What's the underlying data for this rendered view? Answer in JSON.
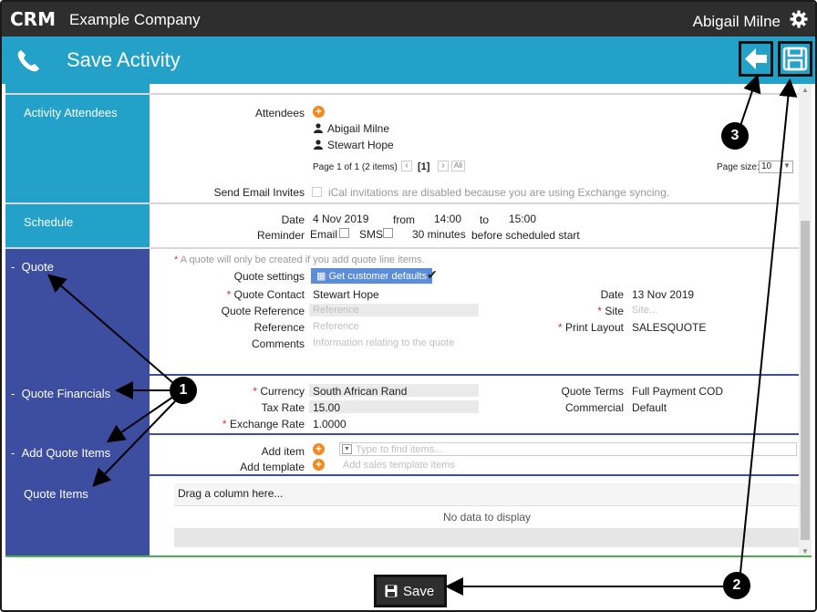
{
  "header": {
    "logo_text": "CRM",
    "company": "Example Company",
    "user": "Abigail Milne"
  },
  "titlebar": {
    "title": "Save Activity"
  },
  "attendees_section": {
    "side_label": "Activity Attendees",
    "attendees_label": "Attendees",
    "attendees": [
      "Abigail Milne",
      "Stewart Hope"
    ],
    "pager_text": "Page 1 of 1 (2 items)",
    "current_page": "[1]",
    "all_label": "All",
    "page_size_label": "Page size:",
    "page_size_value": "10",
    "send_email_label": "Send Email Invites",
    "send_email_note": "iCal invitations are disabled because you are using Exchange syncing."
  },
  "schedule_section": {
    "side_label": "Schedule",
    "date_label": "Date",
    "date_value": "4 Nov 2019",
    "from_label": "from",
    "from_value": "14:00",
    "to_label": "to",
    "to_value": "15:00",
    "reminder_label": "Reminder",
    "email_label": "Email",
    "sms_label": "SMS",
    "minutes_value": "30 minutes",
    "before_label": "before scheduled start"
  },
  "quote_section": {
    "side_label": "Quote",
    "collapse_glyph": "-",
    "note": "A quote will only be created if you add quote line items.",
    "quote_settings_label": "Quote settings",
    "get_defaults_button": "Get customer defaults",
    "quote_contact_label": "Quote Contact",
    "quote_contact_value": "Stewart Hope",
    "quote_reference_label": "Quote Reference",
    "quote_reference_placeholder": "Reference",
    "reference_label": "Reference",
    "reference_placeholder": "Reference",
    "comments_label": "Comments",
    "comments_placeholder": "Information relating to the quote",
    "date_label": "Date",
    "date_value": "13 Nov 2019",
    "site_label": "Site",
    "site_placeholder": "Site...",
    "print_layout_label": "Print Layout",
    "print_layout_value": "SALESQUOTE"
  },
  "quote_financials_section": {
    "side_label": "Quote Financials",
    "currency_label": "Currency",
    "currency_value": "South African Rand",
    "tax_rate_label": "Tax Rate",
    "tax_rate_value": "15.00",
    "exchange_rate_label": "Exchange Rate",
    "exchange_rate_value": "1.0000",
    "quote_terms_label": "Quote Terms",
    "quote_terms_value": "Full Payment COD",
    "commercial_label": "Commercial",
    "commercial_value": "Default"
  },
  "add_quote_items_section": {
    "side_label": "Add Quote Items",
    "add_item_label": "Add item",
    "add_item_placeholder": "Type to find items...",
    "add_template_label": "Add template",
    "add_template_placeholder": "Add sales template items"
  },
  "quote_items_section": {
    "side_label": "Quote Items",
    "group_panel_text": "Drag a column here...",
    "empty_text": "No data to display"
  },
  "footer": {
    "save_label": "Save"
  },
  "callouts": [
    "1",
    "2",
    "3"
  ],
  "colors": {
    "topbar": "#2e2e2e",
    "titlebar": "#23a1c8",
    "side_teal": "#23a1c8",
    "side_navy": "#3d4ea0",
    "add_icon": "#f28a1f",
    "required": "#d0342c",
    "accent_button": "#5b8ddb"
  }
}
